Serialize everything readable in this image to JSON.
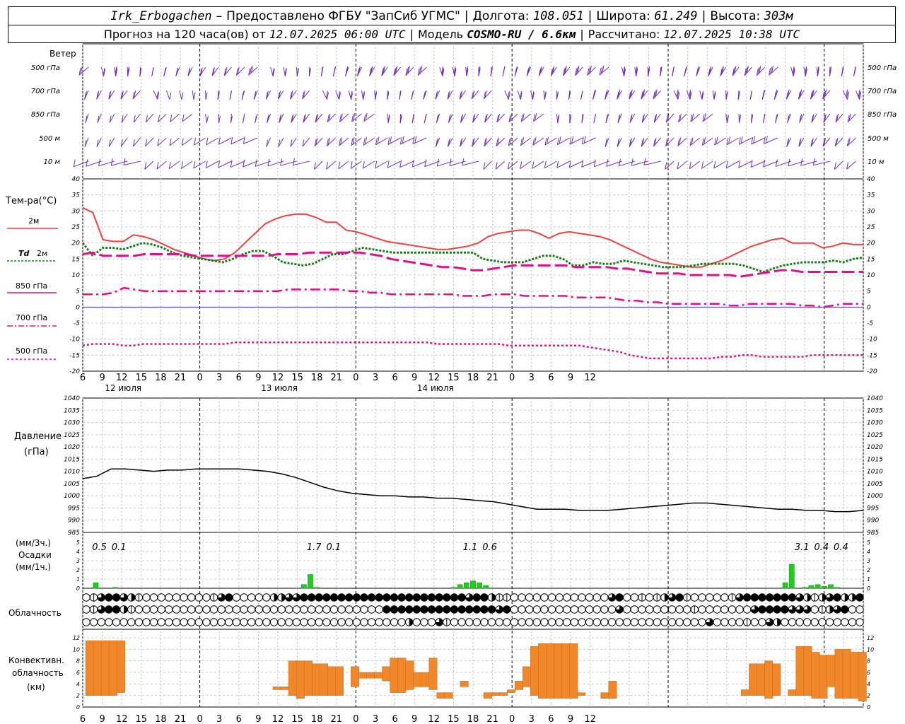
{
  "header": {
    "station": "Irk_Erbogachen",
    "dash": "–",
    "provider": "Предоставлено ФГБУ \"ЗапСиб УГМС\"",
    "lon_label": "Долгота:",
    "lon": "108.051",
    "lat_label": "Широта:",
    "lat": "61.249",
    "alt_label": "Высота:",
    "alt": "303м",
    "forecast_prefix": "Прогноз на 120 часа(ов) от",
    "forecast_from": "12.07.2025 06:00 UTC",
    "model_label": "Модель",
    "model": "COSMO-RU / 6.6км",
    "calc_label": "Рассчитано:",
    "calc": "12.07.2025 10:38 UTC"
  },
  "labels": {
    "wind": "Ветер",
    "temp": "Тем-ра(°C)",
    "t2m": "2м",
    "td": "Td",
    "td2m": "2м",
    "t850": "850 гПа",
    "t700": "700 гПа",
    "t500": "500 гПа",
    "pressure": "Давление",
    "pressure_unit": "(гПа)",
    "precip_3h": "(мм/3ч.)",
    "precip": "Осадки",
    "precip_1h": "(мм/1ч.)",
    "cloud": "Облачность",
    "conv1": "Конвективн.",
    "conv2": "облачность",
    "conv3": "(км)"
  },
  "chart_data": {
    "type": "line",
    "x_hours": [
      0,
      120
    ],
    "time_ticks": [
      "6",
      "9",
      "12",
      "15",
      "18",
      "21",
      "0",
      "3",
      "6",
      "9",
      "12",
      "15",
      "18",
      "21",
      "0",
      "3",
      "6",
      "9",
      "12",
      "15",
      "18",
      "21",
      "0",
      "3",
      "6",
      "9",
      "12"
    ],
    "day_labels": [
      "12 июля",
      "13 июля",
      "14 июля"
    ],
    "wind": {
      "levels": [
        "500 гПа",
        "700 гПа",
        "850 гПа",
        "500 м",
        "10  м"
      ],
      "speed_ms": [
        [
          12,
          12,
          13,
          14,
          12,
          10,
          9,
          8,
          9,
          10,
          11,
          12,
          12,
          13,
          12,
          11,
          11,
          12,
          13,
          14,
          15,
          15,
          15,
          15,
          14,
          14,
          14,
          14,
          14,
          14,
          14,
          14,
          13,
          13,
          13,
          13,
          14,
          14,
          15,
          15,
          15,
          15,
          15,
          15,
          15,
          14,
          14,
          14,
          13,
          13,
          13,
          13,
          13,
          13,
          13,
          13,
          14,
          14,
          15,
          15
        ],
        [
          8,
          9,
          11,
          10,
          9,
          8,
          7,
          6,
          7,
          7,
          8,
          9,
          9,
          9,
          9,
          9,
          10,
          11,
          12,
          12,
          12,
          12,
          12,
          12,
          12,
          12,
          11,
          11,
          11,
          11,
          12,
          12,
          12,
          12,
          12,
          12,
          12,
          12,
          12,
          13,
          13,
          13,
          14,
          14,
          13,
          13,
          13,
          12,
          12,
          12,
          12,
          12,
          13,
          13,
          14,
          14,
          14,
          14,
          13,
          13
        ],
        [
          5,
          6,
          7,
          7,
          6,
          5,
          5,
          5,
          5,
          6,
          6,
          7,
          7,
          7,
          8,
          8,
          8,
          9,
          9,
          9,
          9,
          9,
          10,
          10,
          10,
          10,
          10,
          10,
          10,
          10,
          10,
          10,
          10,
          10,
          11,
          11,
          11,
          11,
          11,
          12,
          12,
          12,
          12,
          12,
          11,
          11,
          11,
          11,
          10,
          10,
          10,
          10,
          11,
          11,
          11,
          12,
          12,
          12,
          12,
          12
        ],
        [
          5,
          5,
          6,
          6,
          5,
          5,
          4,
          4,
          4,
          5,
          5,
          5,
          6,
          6,
          6,
          7,
          7,
          7,
          8,
          8,
          8,
          8,
          8,
          8,
          8,
          8,
          9,
          9,
          9,
          9,
          9,
          9,
          9,
          9,
          9,
          9,
          10,
          10,
          10,
          10,
          10,
          10,
          10,
          10,
          9,
          9,
          9,
          9,
          9,
          9,
          9,
          9,
          9,
          9,
          10,
          10,
          10,
          10,
          10,
          10
        ],
        [
          3,
          3,
          3,
          3,
          2,
          2,
          2,
          2,
          2,
          3,
          3,
          3,
          3,
          3,
          3,
          4,
          4,
          4,
          4,
          4,
          4,
          4,
          4,
          4,
          4,
          4,
          4,
          4,
          4,
          4,
          4,
          4,
          4,
          4,
          4,
          4,
          5,
          5,
          5,
          5,
          5,
          5,
          5,
          5,
          4,
          4,
          4,
          4,
          4,
          4,
          4,
          4,
          4,
          4,
          5,
          5,
          5,
          5,
          5,
          5
        ]
      ]
    },
    "temperature": {
      "ylim": [
        -20,
        40
      ],
      "series": [
        {
          "name": "2м",
          "color": "#f04040",
          "values": [
            31,
            29.5,
            21,
            20.5,
            20.5,
            22.5,
            22,
            21,
            19.5,
            18,
            17,
            16,
            15,
            14.5,
            15,
            17,
            20,
            23,
            26,
            27.5,
            28.5,
            29,
            29,
            28,
            26.5,
            26.5,
            24,
            23.5,
            22.5,
            21.5,
            20.5,
            20,
            19.5,
            19,
            18.5,
            18,
            18,
            18.5,
            19,
            20,
            22,
            23,
            23.5,
            24,
            24,
            23,
            21.5,
            23,
            23.5,
            23,
            22.5,
            22,
            21,
            19.5,
            18,
            16.5,
            15,
            14,
            13.5,
            13,
            12.5,
            12.5,
            13.5,
            14.5,
            16,
            17.5,
            19,
            20,
            21,
            21.5,
            20,
            20,
            20,
            18.5,
            19,
            20,
            19.5,
            19.5
          ]
        },
        {
          "name": "Td 2м",
          "color": "#1a801a",
          "values": [
            20,
            16,
            18.5,
            18.5,
            18,
            19,
            20,
            19.5,
            18.5,
            17,
            16,
            15.5,
            15,
            14.5,
            14,
            15,
            16.5,
            17.5,
            17.5,
            16,
            14,
            13.5,
            13,
            13.5,
            15,
            16.5,
            16.5,
            17.5,
            18.5,
            18,
            17.5,
            17,
            17,
            17,
            17,
            17,
            17,
            17,
            17,
            17,
            15,
            14.5,
            14,
            14,
            14,
            15,
            16,
            16,
            15,
            13,
            13,
            14,
            13.5,
            13.5,
            14.5,
            14,
            13.5,
            13,
            12.5,
            12.5,
            12.5,
            13,
            13.5,
            13.5,
            13.5,
            13.5,
            13,
            12,
            11,
            12,
            13,
            13.5,
            14,
            14,
            14,
            14.5,
            14,
            15,
            15.5
          ]
        },
        {
          "name": "850 гПа",
          "color": "#e0108a",
          "values": [
            16.5,
            17,
            16,
            16,
            16,
            16,
            16.5,
            16.5,
            16.5,
            16.5,
            16.5,
            16,
            16,
            16,
            16,
            16,
            16,
            16,
            16,
            16.5,
            16.5,
            16.5,
            17,
            17,
            17,
            17,
            17,
            17,
            16.5,
            16,
            15,
            14.5,
            14,
            13.5,
            13,
            12.5,
            12.5,
            12,
            11.5,
            11.5,
            12,
            12.5,
            13,
            13,
            13,
            13,
            13,
            13,
            12.5,
            12.5,
            12.5,
            12.5,
            12,
            12,
            11.5,
            11,
            10.5,
            10.5,
            10.5,
            10,
            10,
            10,
            10,
            10,
            9.5,
            10,
            10.5,
            11,
            11.5,
            11.5,
            11,
            11,
            11,
            11,
            11,
            11,
            11
          ]
        },
        {
          "name": "700 гПа",
          "color": "#e0108a",
          "values": [
            4,
            4,
            4,
            4.5,
            6,
            5.5,
            5,
            5,
            5,
            5,
            5,
            5,
            5,
            5,
            5,
            5,
            5,
            5,
            5,
            5,
            5.5,
            5.5,
            5.5,
            5.5,
            5.5,
            5.5,
            5,
            5,
            4.5,
            4.5,
            4,
            4,
            4,
            4,
            4,
            4,
            4,
            3.5,
            3.5,
            3.5,
            4,
            4,
            4,
            3.5,
            3.5,
            3.5,
            3.5,
            3.5,
            3,
            3,
            3,
            3,
            2.5,
            2,
            2,
            1.5,
            1.5,
            1,
            1,
            1,
            1,
            1,
            1,
            0.5,
            0.5,
            1,
            1,
            1,
            1,
            1,
            0.5,
            0.5,
            0,
            0.5,
            1,
            1,
            1
          ]
        },
        {
          "name": "500 гПа",
          "color": "#e0108a",
          "values": [
            -12,
            -11.5,
            -11.5,
            -11.5,
            -12,
            -12,
            -11.5,
            -11.5,
            -11.5,
            -11.5,
            -11.5,
            -11.5,
            -11.5,
            -11.5,
            -11.5,
            -11,
            -11,
            -11,
            -11,
            -11,
            -11,
            -11,
            -11,
            -11,
            -11,
            -11,
            -11,
            -11,
            -11,
            -11,
            -11,
            -11,
            -11,
            -11,
            -11,
            -11.5,
            -11.5,
            -11.5,
            -11.5,
            -11.5,
            -11.5,
            -11.5,
            -12,
            -12,
            -12,
            -12,
            -12,
            -12,
            -12,
            -12,
            -12.5,
            -13,
            -13.5,
            -14,
            -15,
            -15.5,
            -16,
            -16,
            -16,
            -16,
            -16,
            -16,
            -16,
            -15.5,
            -15.5,
            -15,
            -15,
            -15.5,
            -15.5,
            -15.5,
            -15.5,
            -15.5,
            -15,
            -15,
            -15,
            -15,
            -15,
            -15
          ]
        }
      ]
    },
    "pressure": {
      "ylim": [
        985,
        1040
      ],
      "values": [
        1007,
        1008,
        1011,
        1011,
        1010.5,
        1010,
        1010.5,
        1010.5,
        1011,
        1011,
        1011,
        1011,
        1010.5,
        1010,
        1009,
        1007.5,
        1005.5,
        1003.5,
        1002,
        1001,
        1000.5,
        1000,
        1000,
        999.5,
        999.5,
        999,
        999,
        998.5,
        998,
        997.5,
        996.5,
        995.5,
        994.5,
        994.5,
        994.5,
        994,
        994,
        994,
        994.5,
        995,
        995.5,
        996,
        996.5,
        997,
        997,
        996.5,
        996,
        995.5,
        995,
        994.5,
        994.5,
        994,
        994,
        993.5,
        993.5,
        994
      ]
    },
    "precipitation": {
      "ylim": [
        0,
        5
      ],
      "labels_3h": [
        {
          "hour": 3,
          "text": "0.5"
        },
        {
          "hour": 6,
          "text": "0.1"
        },
        {
          "hour": 36,
          "text": "1.7"
        },
        {
          "hour": 39,
          "text": "0.1"
        },
        {
          "hour": 60,
          "text": "1.1"
        },
        {
          "hour": 63,
          "text": "0.6"
        },
        {
          "hour": 111,
          "text": "3.1"
        },
        {
          "hour": 114,
          "text": "0.4"
        },
        {
          "hour": 117,
          "text": "0.4"
        }
      ],
      "bars_1h": [
        [
          2,
          0.6
        ],
        [
          5,
          0.1
        ],
        [
          34,
          0.4
        ],
        [
          35,
          1.5
        ],
        [
          36,
          0.1
        ],
        [
          57,
          0.1
        ],
        [
          58,
          0.4
        ],
        [
          59,
          0.6
        ],
        [
          60,
          0.8
        ],
        [
          61,
          0.6
        ],
        [
          62,
          0.3
        ],
        [
          108,
          0.6
        ],
        [
          109,
          2.6
        ],
        [
          111,
          0.1
        ],
        [
          112,
          0.3
        ],
        [
          113,
          0.4
        ],
        [
          114,
          0.2
        ],
        [
          115,
          0.4
        ],
        [
          116,
          0.1
        ]
      ]
    },
    "cloudiness": {
      "rows": [
        "01344321000000000134000002233444444444444444444444434421100000000000003400101234100000134444444321234224",
        "01344210000000000000000000000000000000004444444444444443400000000000000300000000010000000344443330123400",
        "00000000000000000000000000000000000000000002000310000000000000000000000000000000000300001003200000000000"
      ]
    },
    "convective": {
      "ylim": [
        0,
        12
      ],
      "bars": [
        [
          0,
          2,
          11.5
        ],
        [
          1,
          2,
          11.5
        ],
        [
          2,
          2,
          11.5
        ],
        [
          3,
          2,
          11.5
        ],
        [
          4,
          2.5,
          11.5
        ],
        [
          24,
          3,
          3.5
        ],
        [
          25,
          3,
          3.5
        ],
        [
          26,
          2,
          8
        ],
        [
          27,
          1.5,
          8
        ],
        [
          28,
          2,
          8
        ],
        [
          29,
          2,
          7.5
        ],
        [
          30,
          2,
          7.5
        ],
        [
          31,
          2,
          7
        ],
        [
          32,
          2,
          7
        ],
        [
          34,
          3.5,
          7
        ],
        [
          35,
          5,
          6
        ],
        [
          36,
          5,
          6
        ],
        [
          37,
          5,
          6
        ],
        [
          38,
          4.5,
          7
        ],
        [
          39,
          2.5,
          8.5
        ],
        [
          40,
          2.5,
          8.5
        ],
        [
          41,
          3,
          8
        ],
        [
          42,
          3.5,
          6
        ],
        [
          43,
          3.5,
          6
        ],
        [
          44,
          3,
          8.5
        ],
        [
          45,
          1.5,
          2.5
        ],
        [
          46,
          1.5,
          2.5
        ],
        [
          48,
          3.5,
          4.5
        ],
        [
          51,
          1.5,
          2.5
        ],
        [
          52,
          2,
          2.5
        ],
        [
          53,
          2,
          2.5
        ],
        [
          54,
          2.5,
          3
        ],
        [
          55,
          3,
          4.5
        ],
        [
          56,
          3.5,
          7
        ],
        [
          57,
          2,
          10.5
        ],
        [
          58,
          1.5,
          11
        ],
        [
          59,
          1.5,
          11
        ],
        [
          60,
          1.5,
          11
        ],
        [
          61,
          1.5,
          11
        ],
        [
          62,
          1.5,
          11
        ],
        [
          63,
          2,
          2.5
        ],
        [
          66,
          1.5,
          2.5
        ],
        [
          67,
          1.5,
          4.5
        ],
        [
          84,
          2,
          3
        ],
        [
          85,
          2,
          7.5
        ],
        [
          86,
          2,
          7.5
        ],
        [
          87,
          1.5,
          8
        ],
        [
          88,
          2,
          7.5
        ],
        [
          90,
          2,
          3
        ],
        [
          91,
          2,
          10.5
        ],
        [
          92,
          2,
          10.5
        ],
        [
          93,
          1.5,
          9.5
        ],
        [
          94,
          1.5,
          9
        ],
        [
          95,
          3.5,
          9
        ],
        [
          96,
          1.5,
          10
        ],
        [
          97,
          1.5,
          10
        ],
        [
          98,
          1.5,
          9.5
        ],
        [
          99,
          1,
          9.5
        ]
      ]
    }
  }
}
